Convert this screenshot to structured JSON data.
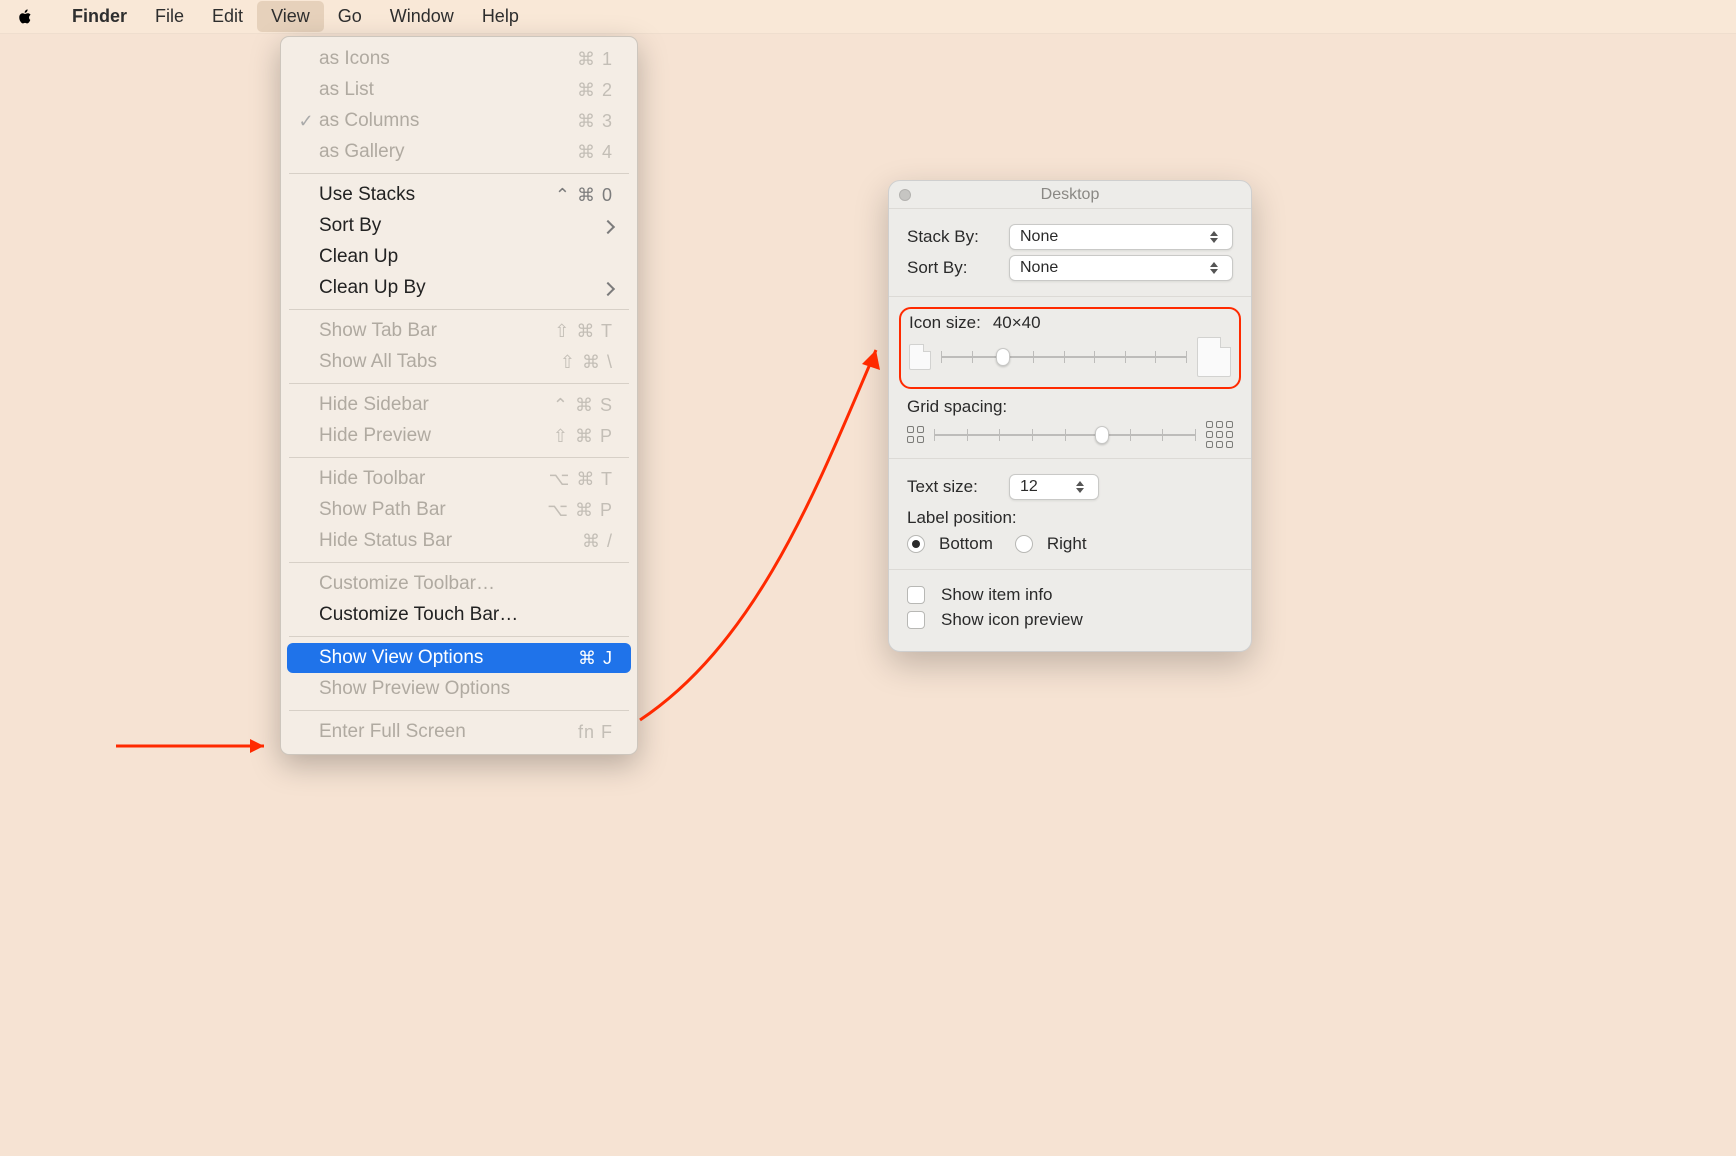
{
  "menubar": {
    "app": "Finder",
    "items": [
      "File",
      "Edit",
      "View",
      "Go",
      "Window",
      "Help"
    ],
    "open_index": 2
  },
  "dropdown": {
    "groups": [
      [
        {
          "label": "as Icons",
          "shortcut": "⌘ 1",
          "disabled": true,
          "checked": false
        },
        {
          "label": "as List",
          "shortcut": "⌘ 2",
          "disabled": true,
          "checked": false
        },
        {
          "label": "as Columns",
          "shortcut": "⌘ 3",
          "disabled": true,
          "checked": true
        },
        {
          "label": "as Gallery",
          "shortcut": "⌘ 4",
          "disabled": true,
          "checked": false
        }
      ],
      [
        {
          "label": "Use Stacks",
          "shortcut": "⌃ ⌘ 0",
          "disabled": false
        },
        {
          "label": "Sort By",
          "submenu": true,
          "disabled": false
        },
        {
          "label": "Clean Up",
          "disabled": false
        },
        {
          "label": "Clean Up By",
          "submenu": true,
          "disabled": false
        }
      ],
      [
        {
          "label": "Show Tab Bar",
          "shortcut": "⇧ ⌘ T",
          "disabled": true
        },
        {
          "label": "Show All Tabs",
          "shortcut": "⇧ ⌘ \\",
          "disabled": true
        }
      ],
      [
        {
          "label": "Hide Sidebar",
          "shortcut": "⌃ ⌘ S",
          "disabled": true
        },
        {
          "label": "Hide Preview",
          "shortcut": "⇧ ⌘ P",
          "disabled": true
        }
      ],
      [
        {
          "label": "Hide Toolbar",
          "shortcut": "⌥ ⌘ T",
          "disabled": true
        },
        {
          "label": "Show Path Bar",
          "shortcut": "⌥ ⌘ P",
          "disabled": true
        },
        {
          "label": "Hide Status Bar",
          "shortcut": "⌘ /",
          "disabled": true
        }
      ],
      [
        {
          "label": "Customize Toolbar…",
          "disabled": true
        },
        {
          "label": "Customize Touch Bar…",
          "disabled": false
        }
      ],
      [
        {
          "label": "Show View Options",
          "shortcut": "⌘ J",
          "disabled": false,
          "highlight": true
        },
        {
          "label": "Show Preview Options",
          "disabled": true
        }
      ],
      [
        {
          "label": "Enter Full Screen",
          "shortcut": "fn F",
          "disabled": true
        }
      ]
    ]
  },
  "panel": {
    "title": "Desktop",
    "stack_by": {
      "label": "Stack By:",
      "value": "None"
    },
    "sort_by": {
      "label": "Sort By:",
      "value": "None"
    },
    "icon_size": {
      "label": "Icon size:",
      "value": "40×40",
      "slider_pct": 25
    },
    "grid_spacing": {
      "label": "Grid spacing:",
      "slider_pct": 64
    },
    "text_size": {
      "label": "Text size:",
      "value": "12"
    },
    "label_position": {
      "label": "Label position:",
      "options": [
        "Bottom",
        "Right"
      ],
      "selected": 0
    },
    "checks": {
      "show_item_info": {
        "label": "Show item info",
        "checked": false
      },
      "show_icon_preview": {
        "label": "Show icon preview",
        "checked": false
      }
    }
  }
}
